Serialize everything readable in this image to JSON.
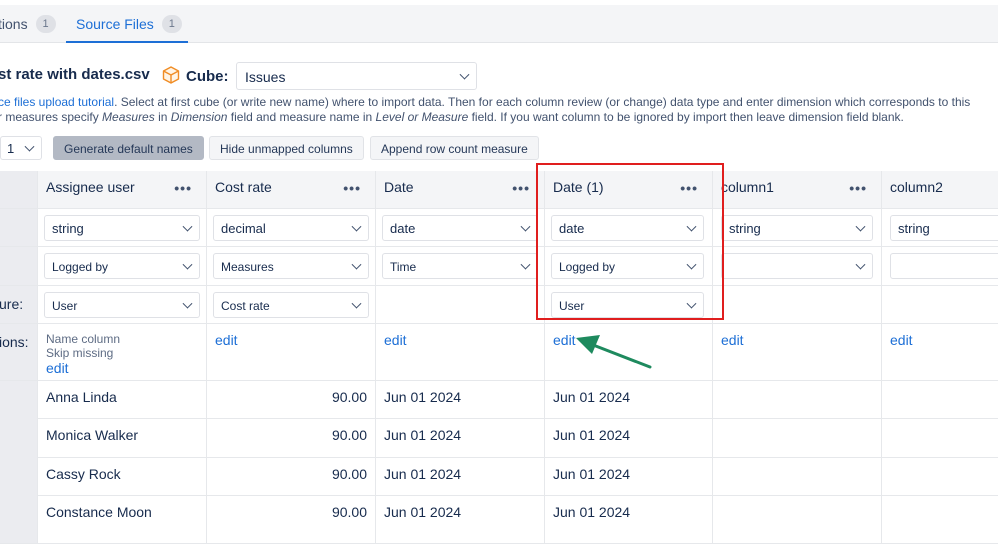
{
  "tabs": [
    {
      "label": "tions",
      "count": "1"
    },
    {
      "label": "Source Files",
      "count": "1"
    }
  ],
  "file": {
    "title": "st rate with dates.csv"
  },
  "cube": {
    "label": "Cube:",
    "value": "Issues"
  },
  "description": {
    "link": "ce files upload tutorial",
    "line1_rest": ". Select at first cube (or write new name) where to import data. Then for each column review (or change) data type and enter dimension which corresponds to this",
    "line2_a": "r measures specify ",
    "line2_i1": "Measures",
    "line2_b": " in ",
    "line2_i2": "Dimension",
    "line2_c": " field and measure name in ",
    "line2_i3": "Level or Measure",
    "line2_d": " field. If you want column to be ignored by import then leave dimension field blank."
  },
  "toolbar": {
    "page_value": "1",
    "generate_label": "Generate default names",
    "hide_label": "Hide unmapped columns",
    "append_label": "Append row count measure"
  },
  "row_labels": {
    "measure": "ure:",
    "options": "ions:"
  },
  "columns": [
    {
      "title": "Assignee user",
      "type": "string",
      "dimension": "Logged by",
      "level": "User",
      "opt1": "Name column",
      "opt2": "Skip missing",
      "edit": "edit"
    },
    {
      "title": "Cost rate",
      "type": "decimal",
      "dimension": "Measures",
      "level": "Cost rate",
      "edit": "edit"
    },
    {
      "title": "Date",
      "type": "date",
      "dimension": "Time",
      "level": "",
      "edit": "edit"
    },
    {
      "title": "Date (1)",
      "type": "date",
      "dimension": "Logged by",
      "level": "User",
      "edit": "edit"
    },
    {
      "title": "column1",
      "type": "string",
      "dimension": "",
      "level": "",
      "edit": "edit"
    },
    {
      "title": "column2",
      "type": "string",
      "dimension": "",
      "level": "",
      "edit": "edit"
    }
  ],
  "rows": [
    {
      "assignee": "Anna Linda",
      "cost": "90.00",
      "date": "Jun 01 2024",
      "date1": "Jun 01 2024"
    },
    {
      "assignee": "Monica Walker",
      "cost": "90.00",
      "date": "Jun 01 2024",
      "date1": "Jun 01 2024"
    },
    {
      "assignee": "Cassy Rock",
      "cost": "90.00",
      "date": "Jun 01 2024",
      "date1": "Jun 01 2024"
    },
    {
      "assignee": "Constance Moon",
      "cost": "90.00",
      "date": "Jun 01 2024",
      "date1": "Jun 01 2024"
    }
  ],
  "colors": {
    "accent": "#1d6fd6",
    "highlight": "#e01e1e",
    "arrow": "#1e8a5e"
  }
}
